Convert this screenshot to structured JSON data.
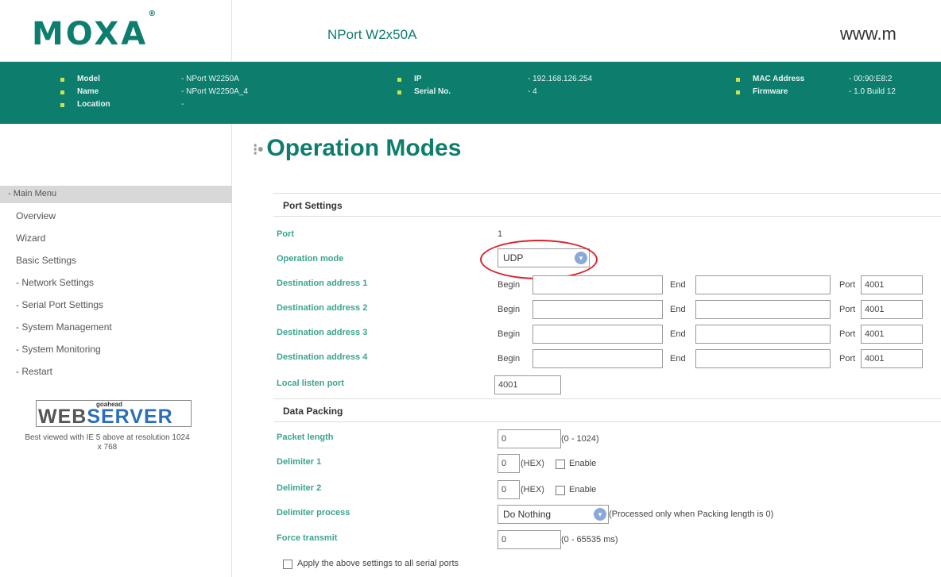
{
  "header": {
    "logo": "MOXA",
    "product": "NPort W2x50A",
    "url": "www.m"
  },
  "info": {
    "model_label": "Model",
    "model_value": "- NPort W2250A",
    "name_label": "Name",
    "name_value": "- NPort W2250A_4",
    "location_label": "Location",
    "location_value": "-",
    "ip_label": "IP",
    "ip_value": "- 192.168.126.254",
    "serial_label": "Serial No.",
    "serial_value": "- 4",
    "mac_label": "MAC Address",
    "mac_value": "- 00:90:E8:2",
    "firmware_label": "Firmware",
    "firmware_value": "- 1.0 Build 12"
  },
  "menu": {
    "header": "- Main Menu",
    "items": [
      "Overview",
      "Wizard",
      "Basic Settings",
      "- Network Settings",
      "- Serial Port Settings",
      "- System Management",
      "- System Monitoring",
      "- Restart"
    ]
  },
  "webserver": {
    "goahead": "goahead",
    "web": "WEB",
    "server": "SERVER",
    "note": "Best viewed with IE 5 above at resolution 1024 x 768"
  },
  "page": {
    "title": "Operation Modes"
  },
  "port_settings": {
    "section_title": "Port Settings",
    "port_label": "Port",
    "port_value": "1",
    "mode_label": "Operation mode",
    "mode_value": "UDP",
    "begin_label": "Begin",
    "end_label": "End",
    "port_field_label": "Port",
    "destinations": [
      {
        "label": "Destination address 1",
        "begin": "",
        "end": "",
        "port": "4001"
      },
      {
        "label": "Destination address 2",
        "begin": "",
        "end": "",
        "port": "4001"
      },
      {
        "label": "Destination address 3",
        "begin": "",
        "end": "",
        "port": "4001"
      },
      {
        "label": "Destination address 4",
        "begin": "",
        "end": "",
        "port": "4001"
      }
    ],
    "local_port_label": "Local listen port",
    "local_port_value": "4001"
  },
  "data_packing": {
    "section_title": "Data Packing",
    "packet_length_label": "Packet length",
    "packet_length_value": "0",
    "packet_length_hint": "(0 - 1024)",
    "delim1_label": "Delimiter 1",
    "delim1_value": "0",
    "delim2_label": "Delimiter 2",
    "delim2_value": "0",
    "hex_label": "(HEX)",
    "enable_label": "Enable",
    "process_label": "Delimiter process",
    "process_value": "Do Nothing",
    "process_hint": "(Processed only when Packing length is 0)",
    "force_label": "Force transmit",
    "force_value": "0",
    "force_hint": "(0 - 65535 ms)"
  },
  "apply_all_label": "Apply the above settings to all serial ports",
  "colors": {
    "brand": "#0d7d6e",
    "label": "#3aa590",
    "highlight": "#d9232e"
  }
}
